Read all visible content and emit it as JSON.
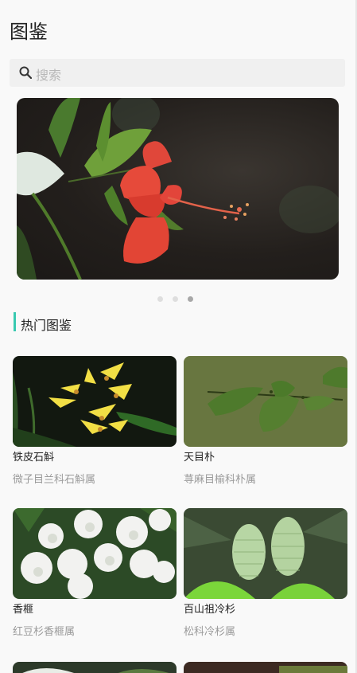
{
  "header": {
    "title": "图鉴"
  },
  "search": {
    "placeholder": "搜索",
    "icon": "search-icon"
  },
  "carousel": {
    "pages": 3,
    "active_index": 2
  },
  "section": {
    "title": "热门图鉴",
    "accent_color": "#38c9b0"
  },
  "plants": [
    {
      "name": "铁皮石斛",
      "taxon": "微子目兰科石斛属"
    },
    {
      "name": "天目朴",
      "taxon": "荨麻目榆科朴属"
    },
    {
      "name": "香榧",
      "taxon": "红豆杉香榧属"
    },
    {
      "name": "百山祖冷杉",
      "taxon": "松科冷杉属"
    }
  ]
}
